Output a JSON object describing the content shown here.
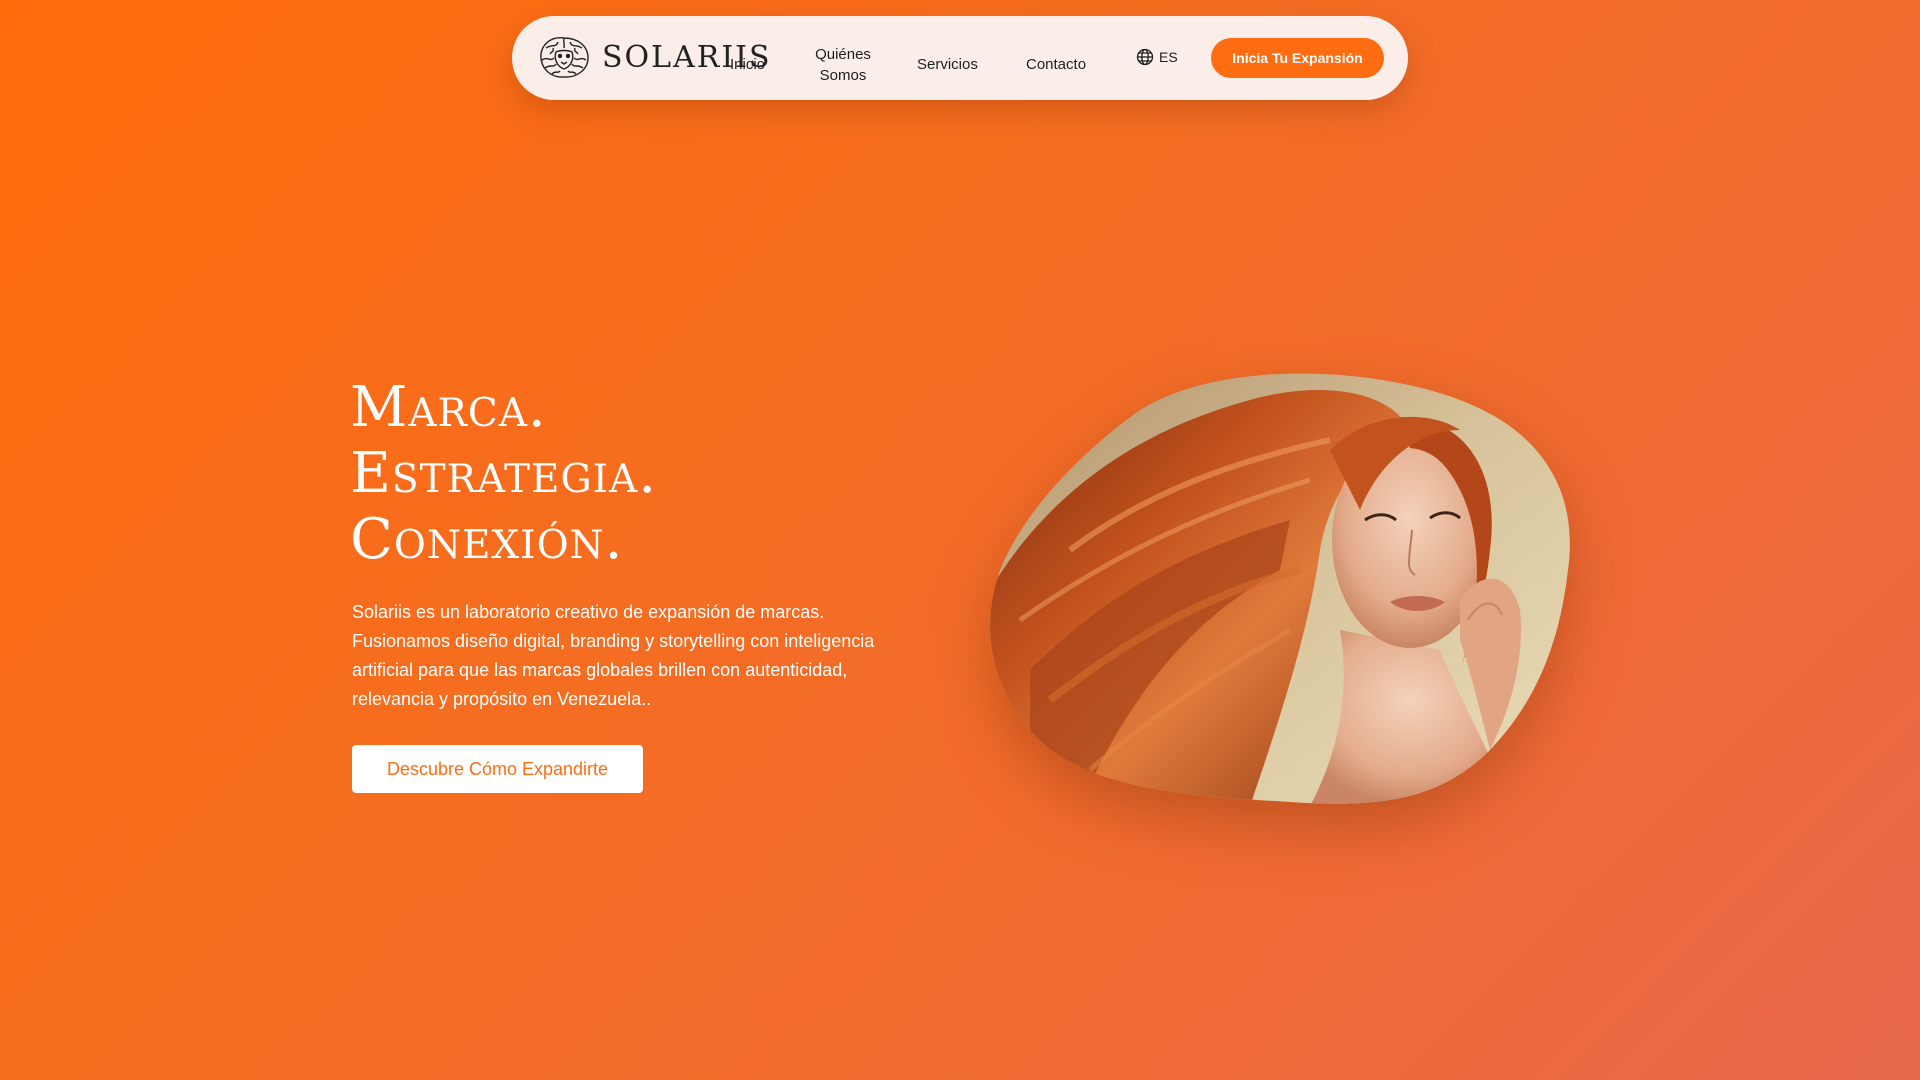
{
  "header": {
    "logo_text": "SOLARIIS",
    "logo_icon": "lion-head-icon",
    "nav": [
      {
        "label": "Inicio"
      },
      {
        "label_line1": "Quiénes",
        "label_line2": "Somos"
      },
      {
        "label": "Servicios"
      },
      {
        "label": "Contacto"
      }
    ],
    "language": {
      "label": "ES",
      "icon": "globe-icon"
    },
    "cta_label": "Inicia Tu Expansión"
  },
  "hero": {
    "title_lines": [
      "Marca.",
      "Estrategia.",
      "Conexión."
    ],
    "description": "Solariis es un laboratorio creativo de expansión de marcas. Fusionamos diseño digital, branding y storytelling con inteligencia artificial para que las marcas globales brillen con autenticidad, relevancia y propósito en Venezuela..",
    "button_label": "Descubre Cómo Expandirte",
    "image": "red-haired-woman-portrait"
  },
  "colors": {
    "brand_orange": "#ff6c11",
    "nav_background": "#fbeee9",
    "text_dark": "#1e1e1e",
    "white": "#ffffff"
  }
}
